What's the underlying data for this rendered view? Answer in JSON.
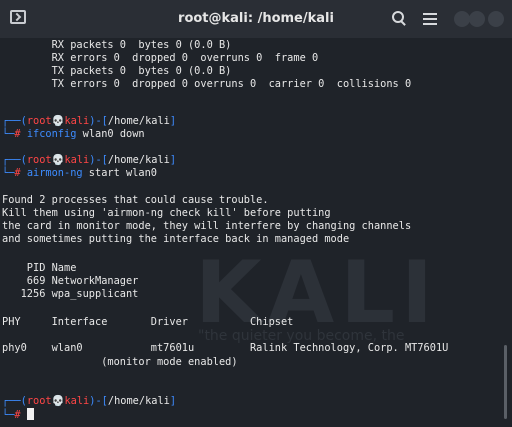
{
  "window": {
    "title": "root@kali: /home/kali"
  },
  "watermark": {
    "text": "KALI",
    "quote": "\"the quieter you become, the"
  },
  "terminal": {
    "prompt": {
      "user_host_open": "┌──(",
      "user": "root",
      "skull": "💀",
      "host": "kali",
      "mid": ")-[",
      "path": "/home/kali",
      "close": "]",
      "line2_prefix": "└─",
      "hash": "#"
    },
    "ifconfig_output": [
      "        RX packets 0  bytes 0 (0.0 B)",
      "        RX errors 0  dropped 0  overruns 0  frame 0",
      "        TX packets 0  bytes 0 (0.0 B)",
      "        TX errors 0  dropped 0 overruns 0  carrier 0  collisions 0"
    ],
    "commands": [
      {
        "cmd": "ifconfig",
        "args": " wlan0 down"
      },
      {
        "cmd": "airmon-ng",
        "args": " start wlan0"
      }
    ],
    "airmon_output": [
      "Found 2 processes that could cause trouble.",
      "Kill them using 'airmon-ng check kill' before putting",
      "the card in monitor mode, they will interfere by changing channels",
      "and sometimes putting the interface back in managed mode",
      "",
      "    PID Name",
      "    669 NetworkManager",
      "   1256 wpa_supplicant",
      "",
      "PHY     Interface       Driver          Chipset",
      "",
      "phy0    wlan0           mt7601u         Ralink Technology, Corp. MT7601U",
      "                (monitor mode enabled)"
    ]
  }
}
